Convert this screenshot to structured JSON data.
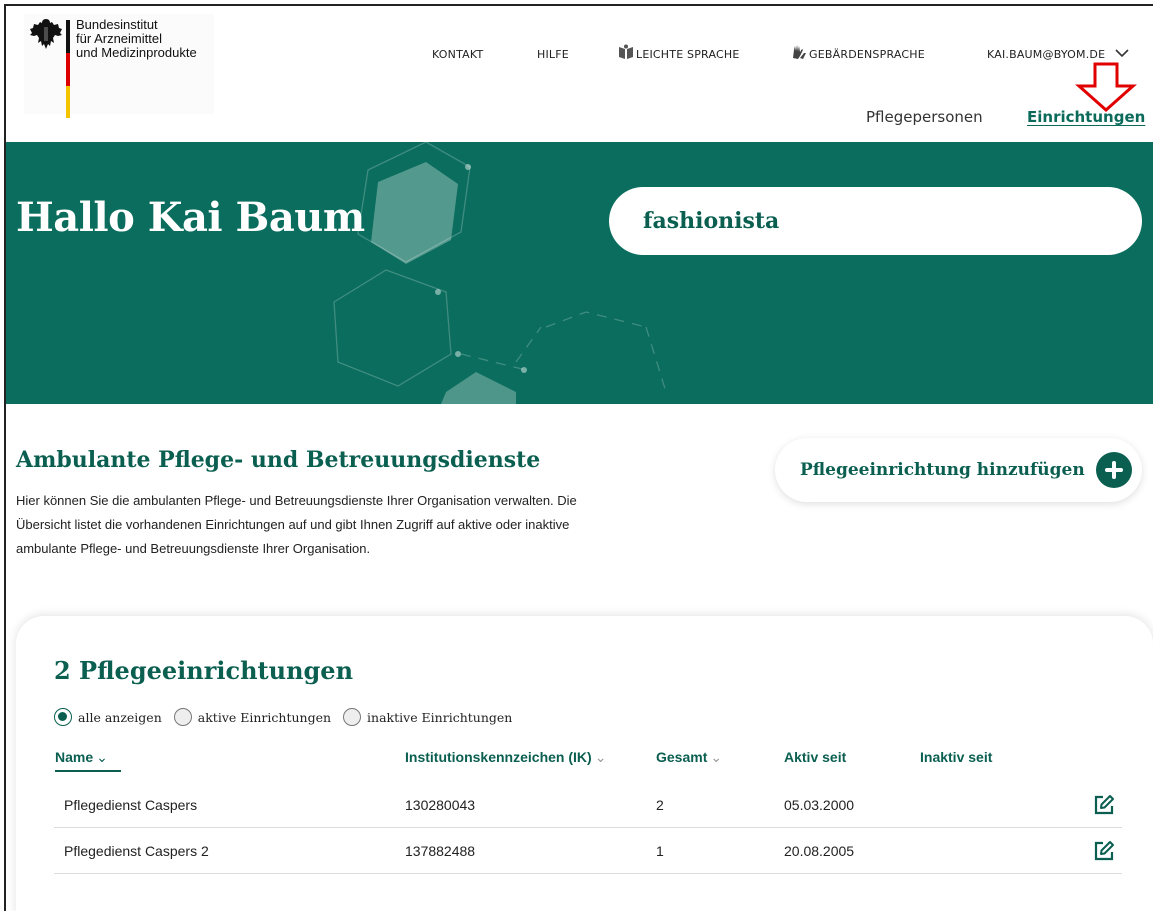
{
  "header": {
    "logo_lines": [
      "Bundesinstitut",
      "für Arzneimittel",
      "und Medizinprodukte"
    ],
    "nav": {
      "kontakt": "KONTAKT",
      "hilfe": "HILFE",
      "leichte_sprache": "LEICHTE SPRACHE",
      "gebaerdensprache": "GEBÄRDENSPRACHE",
      "user": "KAI.BAUM@BYOM.DE"
    },
    "icons": {
      "leichte_sprache": "book-icon",
      "gebaerdensprache": "hands-icon",
      "user_menu": "chevron-down-icon",
      "annotation": "red-down-arrow"
    },
    "subnav": {
      "pflegepersonen": "Pflegepersonen",
      "einrichtungen": "Einrichtungen"
    }
  },
  "hero": {
    "greeting": "Hallo Kai Baum",
    "search_value": "fashionista"
  },
  "intro": {
    "title": "Ambulante Pflege- und Betreuungsdienste",
    "text_lines": [
      "Hier können Sie die ambulanten Pflege- und Betreuungsdienste Ihrer Organisation verwalten. Die",
      "Übersicht listet die vorhandenen Einrichtungen auf und gibt Ihnen Zugriff auf aktive oder inaktive",
      "ambulante Pflege- und Betreuungsdienste Ihrer Organisation."
    ],
    "add_button": "Pflegeeinrichtung hinzufügen"
  },
  "list": {
    "title": "2 Pflegeeinrichtungen",
    "filters": [
      "alle anzeigen",
      "aktive Einrichtungen",
      "inaktive Einrichtungen"
    ],
    "selected_filter": "alle anzeigen",
    "columns": {
      "name": "Name",
      "ik": "Institutionskennzeichen (IK)",
      "gesamt": "Gesamt",
      "aktiv_seit": "Aktiv seit",
      "inaktiv_seit": "Inaktiv seit"
    },
    "rows": [
      {
        "name": "Pflegedienst Caspers",
        "ik": "130280043",
        "gesamt": "2",
        "aktiv_seit": "05.03.2000",
        "inaktiv_seit": ""
      },
      {
        "name": "Pflegedienst Caspers 2",
        "ik": "137882488",
        "gesamt": "1",
        "aktiv_seit": "20.08.2005",
        "inaktiv_seit": ""
      }
    ]
  },
  "colors": {
    "brand_green": "#0a6d5d",
    "text_green": "#0a5f50",
    "annotation_red": "#e00000"
  }
}
